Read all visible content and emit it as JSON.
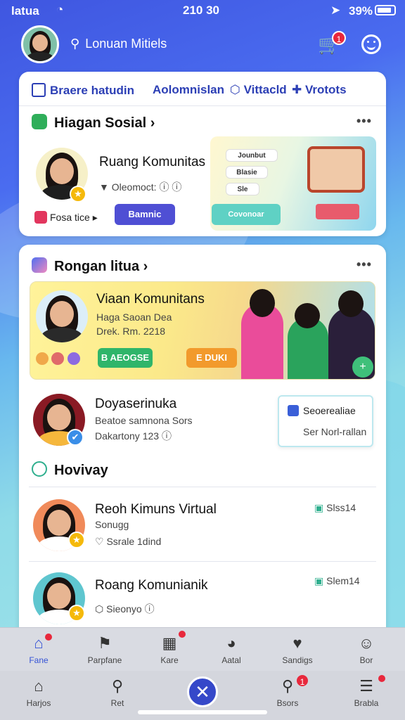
{
  "status_bar": {
    "carrier": "latua",
    "time": "210 30",
    "battery": "39%"
  },
  "header": {
    "search_placeholder": "Lonuan Mitiels",
    "cart_badge": "1"
  },
  "card1": {
    "tabs": [
      "Braere hatudin",
      "Aolomnislan",
      "Vittacld",
      "Vrotots"
    ],
    "section_title": "Hiagan Sosial",
    "item": {
      "title": "Ruang Komunitas",
      "meta": "Oleomoct:",
      "tag": "Fosa tice",
      "button": "Bamnic"
    },
    "promo": {
      "chips": [
        "Jounbut",
        "Blasie",
        "Sle"
      ],
      "button": "Covonoar"
    }
  },
  "card2": {
    "section_title": "Rongan litua",
    "banner": {
      "title": "Viaan Komunitans",
      "line1": "Haga Saoan Dea",
      "line2": "Drek. Rm. 2218",
      "green_button": "B AEOGSE",
      "orange_button": "E DUKI"
    },
    "featured": {
      "title": "Doyaserinuka",
      "sub1": "Beatoe samnona Sors",
      "sub2": "Dakartony 123",
      "note_title": "Seoerealiae",
      "note_sub": "Ser Norl-rallan"
    },
    "subsection_title": "Hovivay",
    "list": [
      {
        "title": "Reoh Kimuns Virtual",
        "sub1": "Sonugg",
        "sub2": "Ssrale 1dind",
        "badge": "Slss14"
      },
      {
        "title": "Roang Komunianik",
        "sub1": "",
        "sub2": "Sieonyo",
        "badge": "Slem14"
      }
    ]
  },
  "nav_top": [
    "Fane",
    "Parpfane",
    "Kare",
    "Aatal",
    "Sandigs",
    "Bor"
  ],
  "nav_bottom": [
    "Harjos",
    "Ret",
    "Bsors",
    "Brabla"
  ],
  "nav_bottom_badge": "1",
  "colors": {
    "primary": "#2c3fb5",
    "accent_red": "#e8283c",
    "star": "#f5b90a"
  }
}
